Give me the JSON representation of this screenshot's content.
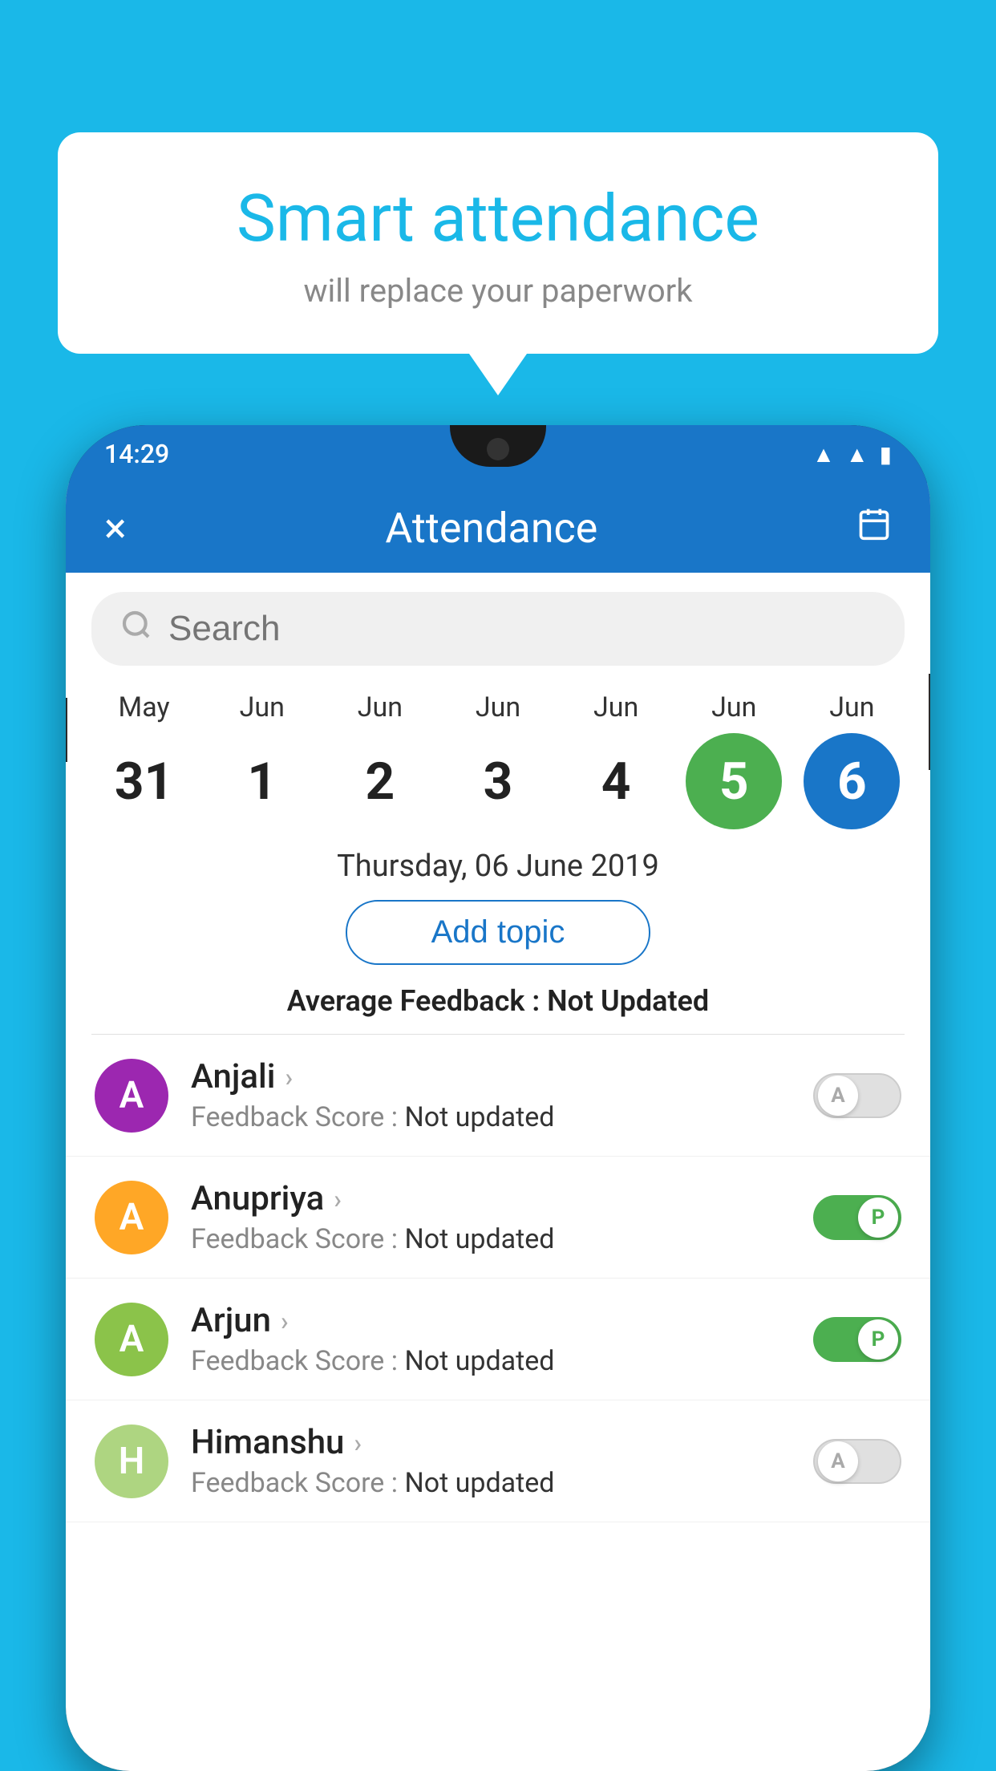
{
  "background_color": "#1ab8e8",
  "speech_bubble": {
    "title": "Smart attendance",
    "subtitle": "will replace your paperwork"
  },
  "status_bar": {
    "time": "14:29",
    "icons": [
      "wifi",
      "signal",
      "battery"
    ]
  },
  "app_header": {
    "title": "Attendance",
    "close_label": "×",
    "calendar_label": "📅"
  },
  "search": {
    "placeholder": "Search"
  },
  "calendar": {
    "days": [
      {
        "month": "May",
        "date": "31",
        "style": "normal"
      },
      {
        "month": "Jun",
        "date": "1",
        "style": "normal"
      },
      {
        "month": "Jun",
        "date": "2",
        "style": "normal"
      },
      {
        "month": "Jun",
        "date": "3",
        "style": "normal"
      },
      {
        "month": "Jun",
        "date": "4",
        "style": "normal"
      },
      {
        "month": "Jun",
        "date": "5",
        "style": "today"
      },
      {
        "month": "Jun",
        "date": "6",
        "style": "selected"
      }
    ],
    "selected_date": "Thursday, 06 June 2019"
  },
  "add_topic_label": "Add topic",
  "average_feedback": {
    "label": "Average Feedback :",
    "value": "Not Updated"
  },
  "students": [
    {
      "name": "Anjali",
      "avatar_letter": "A",
      "avatar_color": "#9c27b0",
      "feedback_label": "Feedback Score :",
      "feedback_value": "Not updated",
      "attendance": "off",
      "toggle_label": "A"
    },
    {
      "name": "Anupriya",
      "avatar_letter": "A",
      "avatar_color": "#ffa726",
      "feedback_label": "Feedback Score :",
      "feedback_value": "Not updated",
      "attendance": "on",
      "toggle_label": "P"
    },
    {
      "name": "Arjun",
      "avatar_letter": "A",
      "avatar_color": "#8bc34a",
      "feedback_label": "Feedback Score :",
      "feedback_value": "Not updated",
      "attendance": "on",
      "toggle_label": "P"
    },
    {
      "name": "Himanshu",
      "avatar_letter": "H",
      "avatar_color": "#aed581",
      "feedback_label": "Feedback Score :",
      "feedback_value": "Not updated",
      "attendance": "off",
      "toggle_label": "A"
    }
  ]
}
